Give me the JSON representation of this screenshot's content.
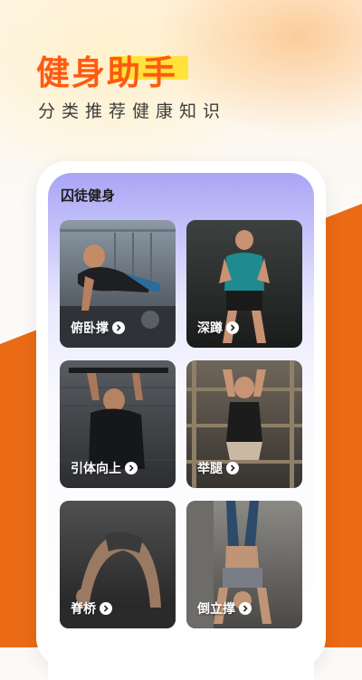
{
  "hero": {
    "title": "健身助手",
    "subtitle": "分类推荐健康知识"
  },
  "phone": {
    "section_title": "囚徒健身",
    "cards": [
      {
        "label": "俯卧撑",
        "icon": "chevron-right-icon"
      },
      {
        "label": "深蹲",
        "icon": "chevron-right-icon"
      },
      {
        "label": "引体向上",
        "icon": "chevron-right-icon"
      },
      {
        "label": "举腿",
        "icon": "chevron-right-icon"
      },
      {
        "label": "脊桥",
        "icon": "chevron-right-icon"
      },
      {
        "label": "倒立撑",
        "icon": "chevron-right-icon"
      }
    ]
  },
  "colors": {
    "brand_orange": "#ea6a15",
    "title_orange": "#ff5a10",
    "highlight_yellow": "#ffe33b",
    "purple_header": "#a9a5f6"
  }
}
